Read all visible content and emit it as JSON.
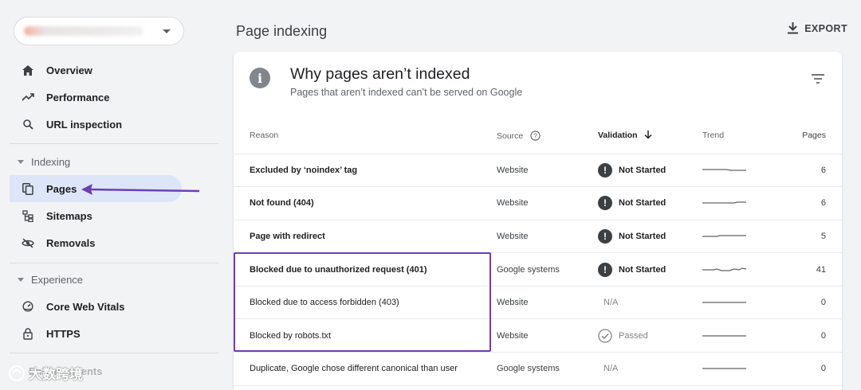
{
  "sidebar": {
    "items": [
      {
        "label": "Overview",
        "icon": "home-icon"
      },
      {
        "label": "Performance",
        "icon": "trending-up-icon"
      },
      {
        "label": "URL inspection",
        "icon": "search-icon"
      }
    ],
    "indexing_section": "Indexing",
    "indexing_items": [
      {
        "label": "Pages",
        "icon": "pages-icon",
        "active": true
      },
      {
        "label": "Sitemaps",
        "icon": "sitemap-icon"
      },
      {
        "label": "Removals",
        "icon": "eye-off-icon"
      }
    ],
    "experience_section": "Experience",
    "experience_items": [
      {
        "label": "Core Web Vitals",
        "icon": "gauge-icon"
      },
      {
        "label": "HTTPS",
        "icon": "lock-icon"
      }
    ],
    "partial_item": "Enhancements"
  },
  "watermark": "大数跨境",
  "header": {
    "title": "Page indexing",
    "export_label": "EXPORT"
  },
  "card": {
    "title": "Why pages aren’t indexed",
    "subtitle": "Pages that aren’t indexed can’t be served on Google",
    "columns": {
      "reason": "Reason",
      "source": "Source",
      "validation": "Validation",
      "trend": "Trend",
      "pages": "Pages"
    },
    "rows": [
      {
        "reason": "Excluded by ‘noindex’ tag",
        "source": "Website",
        "validation": "Not Started",
        "pages": "6"
      },
      {
        "reason": "Not found (404)",
        "source": "Website",
        "validation": "Not Started",
        "pages": "6"
      },
      {
        "reason": "Page with redirect",
        "source": "Website",
        "validation": "Not Started",
        "pages": "5"
      },
      {
        "reason": "Blocked due to unauthorized request (401)",
        "source": "Google systems",
        "validation": "Not Started",
        "pages": "41"
      },
      {
        "reason": "Blocked due to access forbidden (403)",
        "source": "Website",
        "validation": "N/A",
        "pages": "0"
      },
      {
        "reason": "Blocked by robots.txt",
        "source": "Website",
        "validation": "Passed",
        "pages": "0"
      },
      {
        "reason": "Duplicate, Google chose different canonical than user",
        "source": "Google systems",
        "validation": "N/A",
        "pages": "0"
      }
    ]
  },
  "colors": {
    "accent": "#6c3fb6",
    "active_bg": "#dde6f8"
  }
}
